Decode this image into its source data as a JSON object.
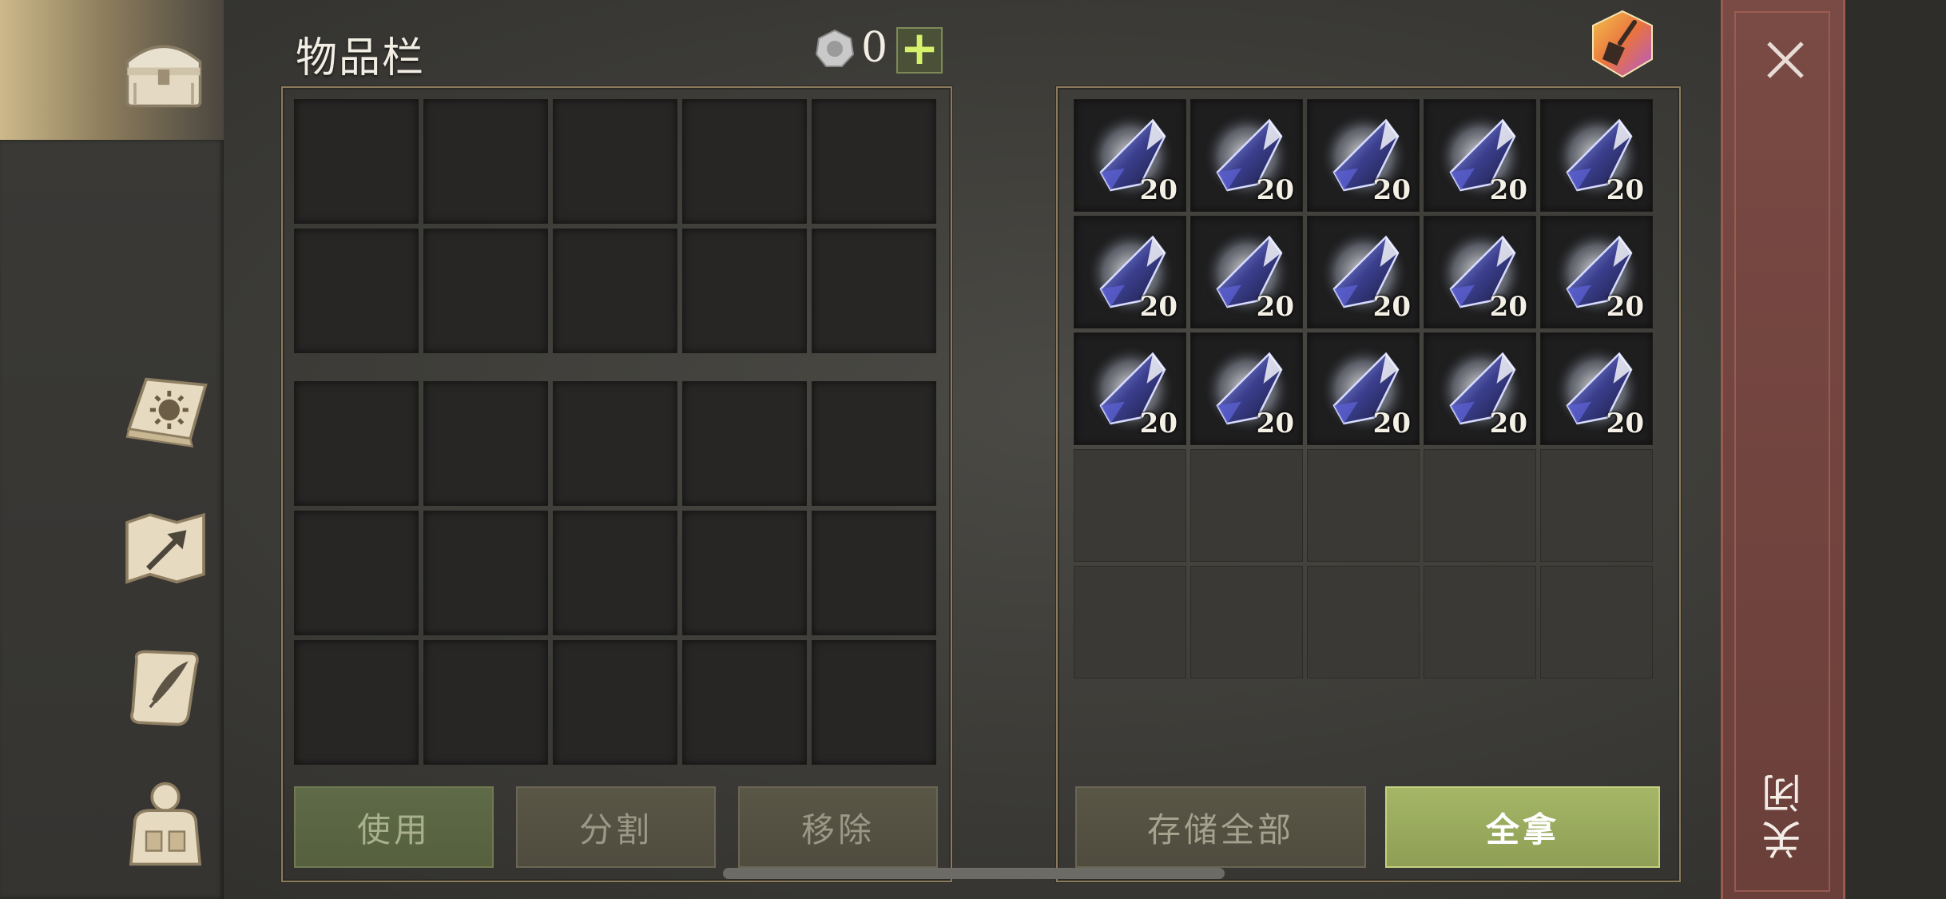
{
  "inventory": {
    "title": "物品栏",
    "currency_count": "0",
    "add_label": "+",
    "buttons": {
      "use": "使用",
      "split": "分割",
      "remove": "移除"
    }
  },
  "container": {
    "items": [
      {
        "name": "crystal",
        "count": "20"
      },
      {
        "name": "crystal",
        "count": "20"
      },
      {
        "name": "crystal",
        "count": "20"
      },
      {
        "name": "crystal",
        "count": "20"
      },
      {
        "name": "crystal",
        "count": "20"
      },
      {
        "name": "crystal",
        "count": "20"
      },
      {
        "name": "crystal",
        "count": "20"
      },
      {
        "name": "crystal",
        "count": "20"
      },
      {
        "name": "crystal",
        "count": "20"
      },
      {
        "name": "crystal",
        "count": "20"
      },
      {
        "name": "crystal",
        "count": "20"
      },
      {
        "name": "crystal",
        "count": "20"
      },
      {
        "name": "crystal",
        "count": "20"
      },
      {
        "name": "crystal",
        "count": "20"
      },
      {
        "name": "crystal",
        "count": "20"
      }
    ],
    "buttons": {
      "store_all": "存储全部",
      "take_all": "全拿"
    }
  },
  "close": {
    "label": "关闭"
  },
  "nav": {
    "items": [
      {
        "icon": "chest-icon",
        "active": true
      },
      {
        "icon": "journal-sun-icon",
        "active": false
      },
      {
        "icon": "map-arrow-icon",
        "active": false
      },
      {
        "icon": "scroll-quill-icon",
        "active": false
      },
      {
        "icon": "character-backpack-icon",
        "active": false
      }
    ]
  },
  "colors": {
    "accent_green": "#a5b667",
    "close_red": "#7a4a44",
    "frame_gold": "#8b7b5c"
  }
}
